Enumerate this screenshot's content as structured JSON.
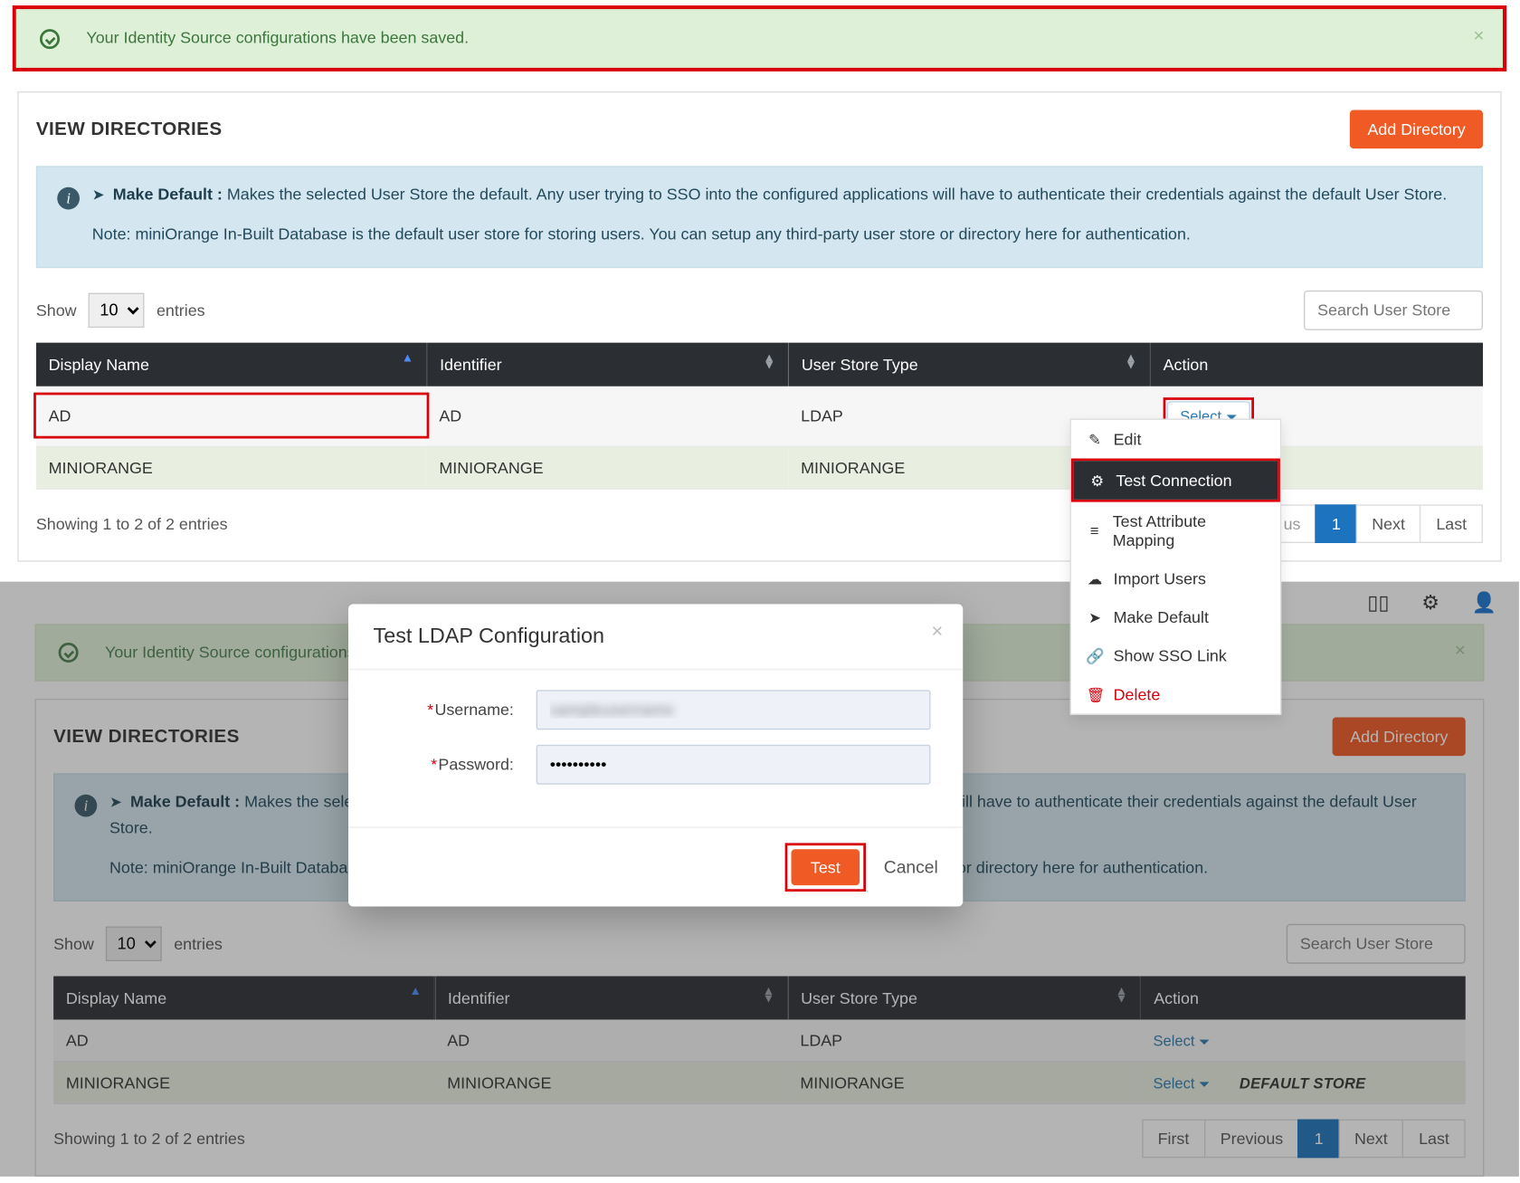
{
  "alert_msg": "Your Identity Source configurations have been saved.",
  "card_title": "VIEW DIRECTORIES",
  "add_dir": "Add Directory",
  "notice_bold": "Make Default :",
  "notice_text1": "Makes the selected User Store the default. Any user trying to SSO into the configured applications will have to authenticate their credentials against the default User Store.",
  "notice_text2": "Note: miniOrange In-Built Database is the default user store for storing users. You can setup any third-party user store or directory here for authentication.",
  "show_lbl": "Show",
  "entries_lbl": "entries",
  "show_val": "10",
  "search_ph": "Search User Store",
  "cols": {
    "c1": "Display Name",
    "c2": "Identifier",
    "c3": "User Store Type",
    "c4": "Action"
  },
  "rows": [
    {
      "dn": "AD",
      "id": "AD",
      "type": "LDAP"
    },
    {
      "dn": "MINIORANGE",
      "id": "MINIORANGE",
      "type": "MINIORANGE"
    }
  ],
  "select_lbl": "Select",
  "showing": "Showing 1 to 2 of 2 entries",
  "pager": {
    "first": "First",
    "prev": "Previous",
    "p1": "1",
    "next": "Next",
    "last": "Last"
  },
  "prev_short": "us",
  "default_store": "DEFAULT STORE",
  "menu": {
    "edit": "Edit",
    "tc": "Test Connection",
    "tam": "Test Attribute Mapping",
    "imp": "Import Users",
    "md": "Make Default",
    "sso": "Show SSO Link",
    "del": "Delete"
  },
  "modal": {
    "title": "Test LDAP Configuration",
    "user": "Username:",
    "pass": "Password:",
    "test": "Test",
    "cancel": "Cancel",
    "user_val": "sampleusername",
    "pass_val": "••••••••••"
  }
}
